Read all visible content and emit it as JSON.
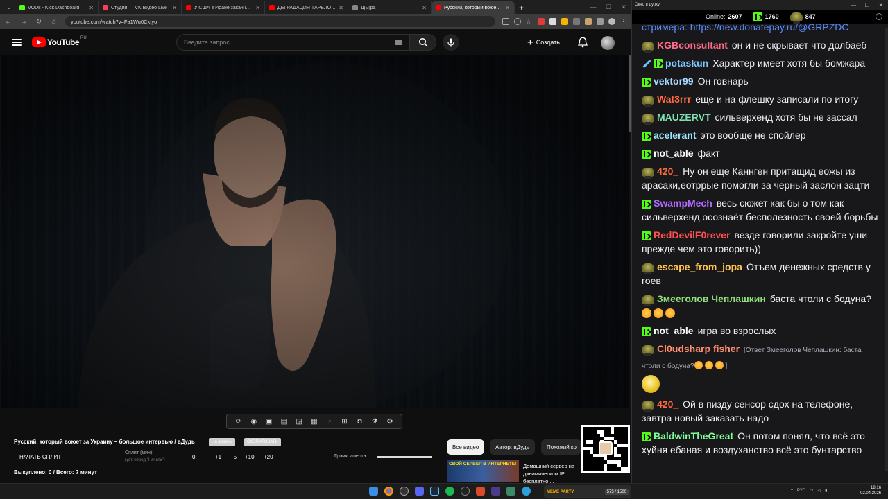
{
  "browser": {
    "tabs": [
      {
        "label": "VODs - Kick Dashboard",
        "color": "#53fc18",
        "active": false
      },
      {
        "label": "Студия — VK Видео Live",
        "color": "#ff3b5c",
        "active": false
      },
      {
        "label": "У США в Иране заканчиваются",
        "color": "#ff0000",
        "active": false
      },
      {
        "label": "ДЕГРАДАЦИЯ ТАРЕЛОЧНИЦ",
        "color": "#ff0000",
        "active": false
      },
      {
        "label": "Д[ы]ра",
        "color": "#888888",
        "active": false
      },
      {
        "label": "Русский, который воюет за У...",
        "color": "#ff0000",
        "active": true
      }
    ],
    "url": "youtube.com/watch?v=Fa1Wu0Cktyo"
  },
  "youtube": {
    "logo_text": "YouTube",
    "country": "RU",
    "search_placeholder": "Введите запрос",
    "create_label": "Создать",
    "video_title": "Русский, который воюет за Украину – большое интервью / вДудь",
    "pill_announce": "На анонсы",
    "pill_copy": "СКОПИРОВАТЬ",
    "split_start": "НАЧАТЬ СПЛИТ",
    "split_label": "Сплит (мин):",
    "split_hint": "(уст. перед \"Начать\")",
    "steps": [
      "0",
      "+1",
      "+5",
      "+10",
      "+20"
    ],
    "volume_label": "Громк. алерта:",
    "bought": "Выкуплено: 0 / Всего: ? минут",
    "filters": [
      "Все видео",
      "Автор: вДудь",
      "Похожий ко"
    ],
    "rec_thumb_text": "СВОЙ СЕРВЕР В ИНТЕРНЕТЕ!",
    "rec_title": "Домашний сервер на динамическом IP бесплатно!..."
  },
  "chat": {
    "window_title": "Окно в дурку",
    "online_label": "Online:",
    "online_count": "2607",
    "kick_count": "1760",
    "pepe_count": "847",
    "messages": [
      {
        "badges": [],
        "user": "",
        "color": "#efeff1",
        "text": "стримера: https://new.donatepay.ru/@GRPZDC",
        "link": true
      },
      {
        "badges": [
          "pepe"
        ],
        "user": "KGBconsultant",
        "color": "#ff6b8a",
        "text": "он и не скрывает что долбаеб"
      },
      {
        "badges": [
          "sword",
          "kick"
        ],
        "user": "potaskun",
        "color": "#7ec8ff",
        "text": "Характер имеет хотя бы бомжара"
      },
      {
        "badges": [
          "kick"
        ],
        "user": "vektor99",
        "color": "#a8d8ff",
        "text": "Он говнарь"
      },
      {
        "badges": [
          "pepe"
        ],
        "user": "Wat3rrr",
        "color": "#ff6b3d",
        "text": "еще и на флешку записали по итогу"
      },
      {
        "badges": [
          "pepe"
        ],
        "user": "MAUZERVT",
        "color": "#7ee0b0",
        "text": "сильверхенд хотя бы не зассал"
      },
      {
        "badges": [
          "kick"
        ],
        "user": "acelerant",
        "color": "#9ee5ff",
        "text": "это вообще не спойлер"
      },
      {
        "badges": [
          "kick"
        ],
        "user": "not_able",
        "color": "#ffffff",
        "text": "факт"
      },
      {
        "badges": [
          "pepe"
        ],
        "user": "420_",
        "color": "#ff6b3d",
        "text": "Ну он еще Каннген притащид еожы из арасаки,еотррые помогли за черный заслон зацти"
      },
      {
        "badges": [
          "kick"
        ],
        "user": "SwampMech",
        "color": "#b26bff",
        "text": "весь сюжет как бы о том как сильверхенд осознаёт бесполезность своей борьбы"
      },
      {
        "badges": [
          "kick"
        ],
        "user": "RedDevilF0rever",
        "color": "#ff4f4f",
        "text": "везде говорили закройте уши прежде чем это говорить))"
      },
      {
        "badges": [
          "pepe"
        ],
        "user": "escape_from_jopa",
        "color": "#ffc34d",
        "text": "Отъем денежных средств у гоев"
      },
      {
        "badges": [
          "pepe"
        ],
        "user": "Змееголов Чеплашкин",
        "color": "#8ee07a",
        "text": "баста чтоли с бодуна?",
        "emojis": 3
      },
      {
        "badges": [
          "kick"
        ],
        "user": "not_able",
        "color": "#ffffff",
        "text": "игра во взрослых"
      },
      {
        "badges": [
          "pepe"
        ],
        "user": "Cl0udsharp fisher",
        "color": "#ff8c6b",
        "text": "",
        "reply": "[Ответ Змееголов Чеплашкин: баста чтоли с бодуна?",
        "reply_tail": "]",
        "emote": true
      },
      {
        "badges": [
          "pepe"
        ],
        "user": "420_",
        "color": "#ff6b3d",
        "text": "Ой в пизду сенсор сдох на телефоне, завтра новый заказать надо"
      },
      {
        "badges": [
          "kick"
        ],
        "user": "BaldwinTheGreat",
        "color": "#7cff9a",
        "text": "Он потом понял, что всё это хуйня ебаная и воздуханство всё это бунтарство"
      }
    ]
  },
  "taskbar": {
    "media_logo": "MEME PARTY",
    "media_count": "575 / 1500",
    "lang": "РУС",
    "time": "18:16",
    "date": "02.04.2026"
  }
}
